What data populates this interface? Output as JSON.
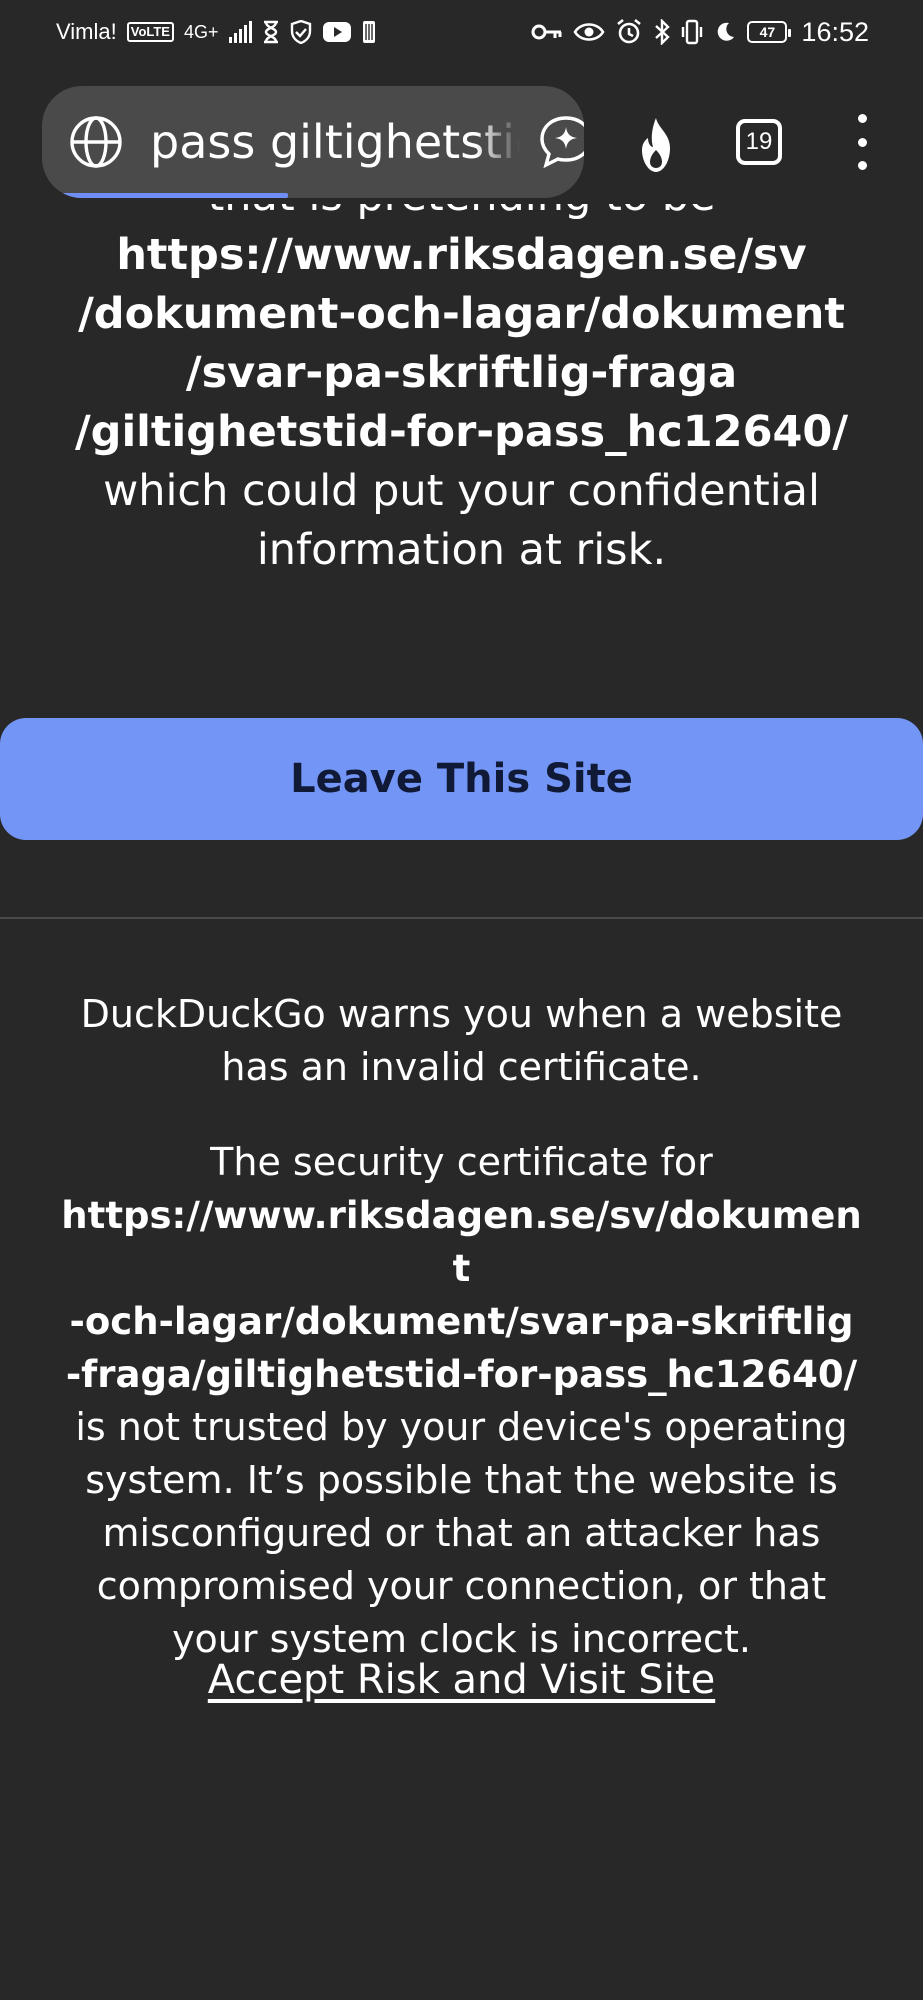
{
  "status_bar": {
    "carrier": "Vimla!",
    "volte": "VoLTE",
    "network": "4G+",
    "battery": "47",
    "time": "16:52"
  },
  "toolbar": {
    "url_text": "pass giltighetstid",
    "tab_count": "19",
    "progress_fraction": 0.45,
    "accent_color": "#6f8ef5",
    "icons": [
      "globe-icon",
      "chat-sparkle-icon",
      "fire-icon",
      "tabs-icon",
      "more-vert-icon"
    ]
  },
  "warning": {
    "partial_line": "that is pretending to be",
    "url": "https://www.riksdagen.se/sv/dokument-och-lagar/dokument/svar-pa-skriftlig-fraga/giltighetstid-for-pass_hc12640/",
    "url_lines": [
      "https://www.riksdagen.se/sv",
      "/dokument-och-lagar/dokument",
      "/svar-pa-skriftlig-fraga",
      "/giltighetstid-for-pass_hc12640/"
    ],
    "risk_text": "which could put your confidential information at risk.",
    "leave_label": "Leave This Site",
    "leave_color": "#7395f5"
  },
  "details": {
    "intro": "DuckDuckGo warns you when a website has an invalid certificate.",
    "cert_prefix": "The security certificate for",
    "cert_url_lines": [
      "https://www.riksdagen.se/sv/dokument",
      "-och-lagar/dokument/svar-pa-skriftlig",
      "-fraga/giltighetstid-for-pass_hc12640/"
    ],
    "cert_suffix": "is not trusted by your device's operating system. It’s possible that the website is misconfigured or that an attacker has compromised your connection, or that your system clock is incorrect.",
    "accept_label": "Accept Risk and Visit Site"
  }
}
